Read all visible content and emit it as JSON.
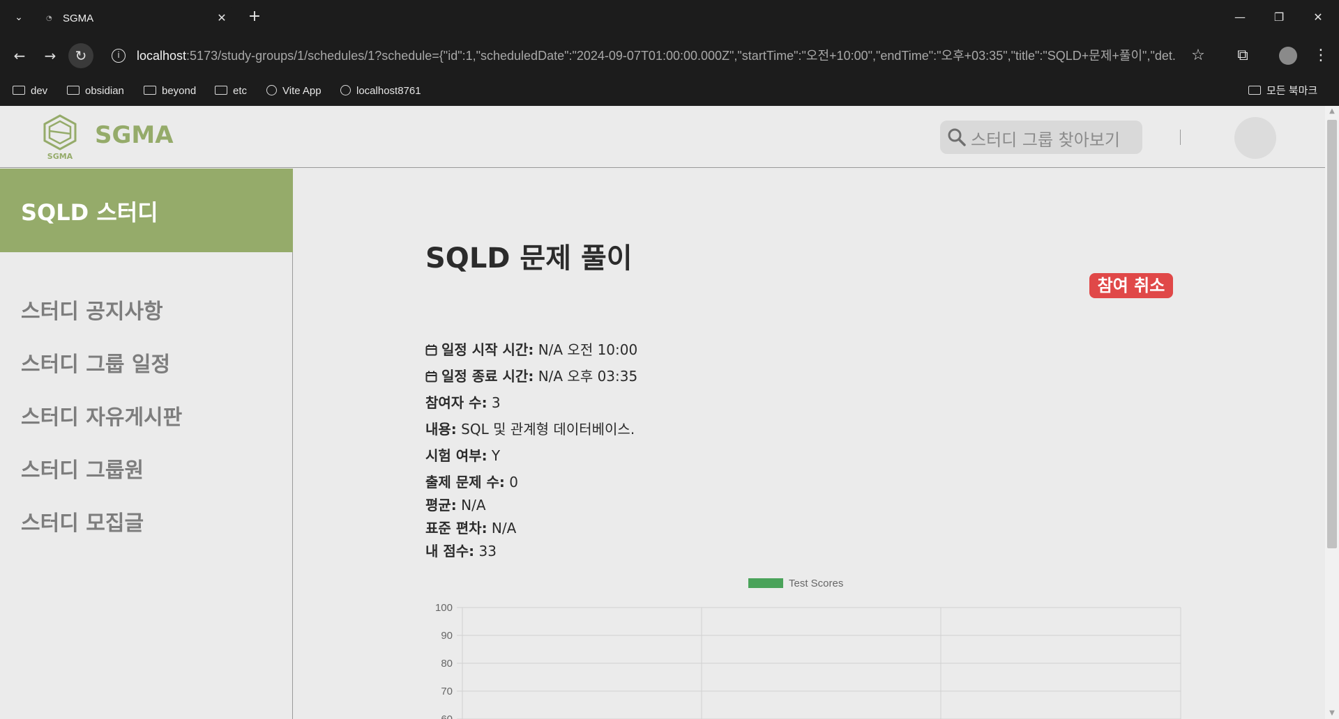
{
  "browser": {
    "tab_title": "SGMA",
    "tab_close": "✕",
    "url_host": "localhost",
    "url_rest": ":5173/study-groups/1/schedules/1?schedule={\"id\":1,\"scheduledDate\":\"2024-09-07T01:00:00.000Z\",\"startTime\":\"오전+10:00\",\"endTime\":\"오후+03:35\",\"title\":\"SQLD+문제+풀이\",\"det...",
    "bookmarks": [
      {
        "label": "dev",
        "icon": "folder-icon"
      },
      {
        "label": "obsidian",
        "icon": "folder-icon"
      },
      {
        "label": "beyond",
        "icon": "folder-icon"
      },
      {
        "label": "etc",
        "icon": "folder-icon"
      },
      {
        "label": "Vite App",
        "icon": "vite-icon"
      },
      {
        "label": "localhost8761",
        "icon": "globe-icon"
      }
    ],
    "all_bookmarks": "모든 북마크"
  },
  "header": {
    "logo_text": "SGMA",
    "logo_sub": "SGMA",
    "search_placeholder": "스터디 그룹 찾아보기"
  },
  "sidebar": {
    "title": "SQLD 스터디",
    "items": [
      {
        "label": "스터디 공지사항"
      },
      {
        "label": "스터디 그룹 일정"
      },
      {
        "label": "스터디 자유게시판"
      },
      {
        "label": "스터디 그룹원"
      },
      {
        "label": "스터디 모집글"
      }
    ]
  },
  "schedule": {
    "title": "SQLD 문제 풀이",
    "cancel_label": "참여 취소",
    "start_label": "일정 시작 시간:",
    "start_value": "N/A 오전 10:00",
    "end_label": "일정 종료 시간:",
    "end_value": "N/A 오후 03:35",
    "participants_label": "참여자 수:",
    "participants_value": "3",
    "content_label": "내용:",
    "content_value": "SQL 및 관계형 데이터베이스.",
    "exam_label": "시험 여부:",
    "exam_value": "Y",
    "questions_label": "출제 문제 수:",
    "questions_value": "0",
    "average_label": "평균:",
    "average_value": "N/A",
    "stddev_label": "표준 편차:",
    "stddev_value": "N/A",
    "my_score_label": "내 점수:",
    "my_score_value": "33"
  },
  "chart_data": {
    "type": "bar",
    "series": [
      {
        "name": "Test Scores",
        "values": []
      }
    ],
    "legend": "top-center",
    "legend_color": "#4aa35a",
    "y_ticks": [
      100,
      90,
      80,
      70,
      60
    ],
    "grid": true
  },
  "colors": {
    "brand": "#95ab6a",
    "danger": "#e04848"
  }
}
